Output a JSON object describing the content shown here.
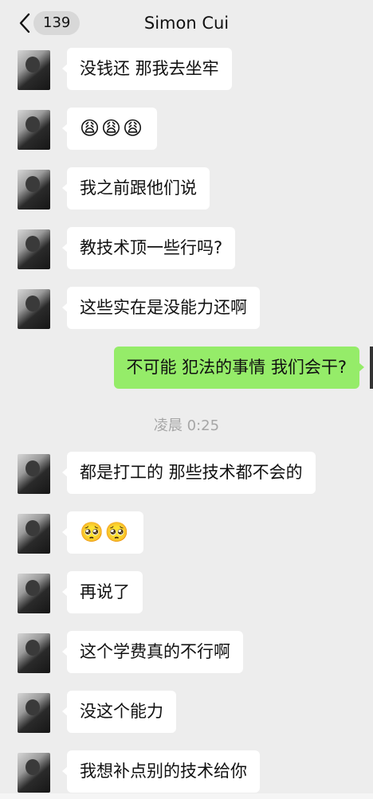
{
  "header": {
    "badge_count": "139",
    "title": "Simon Cui"
  },
  "messages": [
    {
      "side": "left",
      "text": "没钱还 那我去坐牢"
    },
    {
      "side": "left",
      "text": "😩😩😩"
    },
    {
      "side": "left",
      "text": "我之前跟他们说"
    },
    {
      "side": "left",
      "text": "教技术顶一些行吗?"
    },
    {
      "side": "left",
      "text": "这些实在是没能力还啊"
    },
    {
      "side": "right",
      "text": "不可能 犯法的事情 我们会干?"
    },
    {
      "side": "time",
      "text": "凌晨 0:25"
    },
    {
      "side": "left",
      "text": "都是打工的 那些技术都不会的"
    },
    {
      "side": "left",
      "text": "🥺🥺"
    },
    {
      "side": "left",
      "text": "再说了"
    },
    {
      "side": "left",
      "text": "这个学费真的不行啊"
    },
    {
      "side": "left",
      "text": "没这个能力"
    },
    {
      "side": "left",
      "text": "我想补点别的技术给你"
    }
  ]
}
